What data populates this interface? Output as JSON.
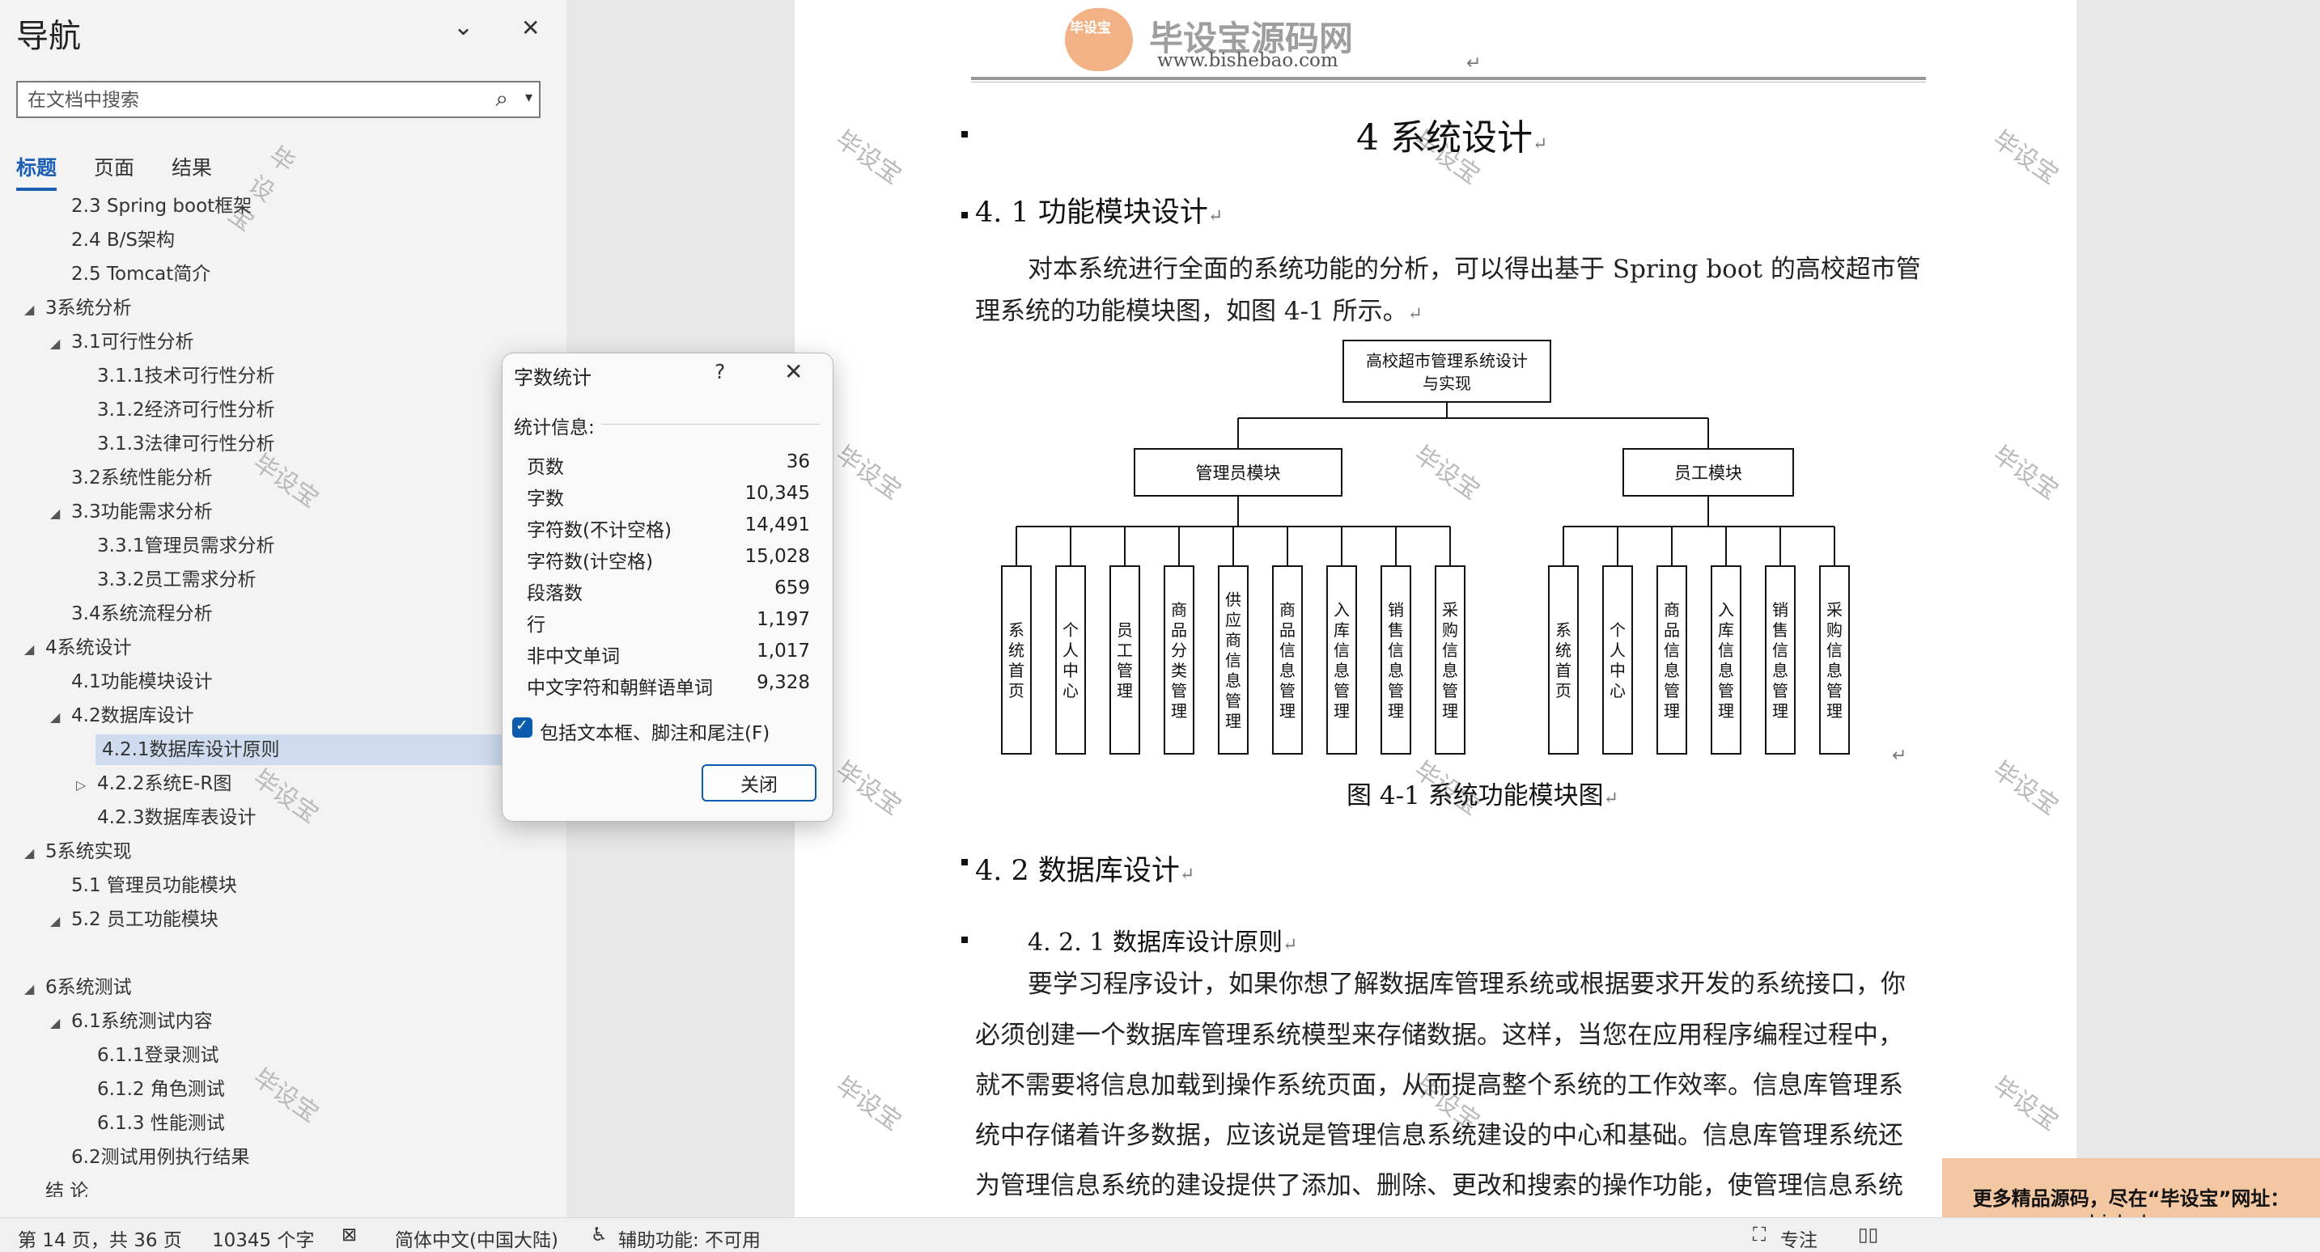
{
  "nav": {
    "title": "导航",
    "search_placeholder": "在文档中搜索",
    "tabs": [
      "标题",
      "页面",
      "结果"
    ],
    "tree": [
      {
        "label": "2.3 Spring boot框架",
        "indent": 2,
        "arrow": ""
      },
      {
        "label": "2.4 B/S架构",
        "indent": 2,
        "arrow": ""
      },
      {
        "label": "2.5 Tomcat简介",
        "indent": 2,
        "arrow": ""
      },
      {
        "label": "3系统分析",
        "indent": 1,
        "arrow": "◢"
      },
      {
        "label": "3.1可行性分析",
        "indent": 2,
        "arrow": "◢"
      },
      {
        "label": "3.1.1技术可行性分析",
        "indent": 3,
        "arrow": ""
      },
      {
        "label": "3.1.2经济可行性分析",
        "indent": 3,
        "arrow": ""
      },
      {
        "label": "3.1.3法律可行性分析",
        "indent": 3,
        "arrow": ""
      },
      {
        "label": "3.2系统性能分析",
        "indent": 2,
        "arrow": ""
      },
      {
        "label": "3.3功能需求分析",
        "indent": 2,
        "arrow": "◢"
      },
      {
        "label": "3.3.1管理员需求分析",
        "indent": 3,
        "arrow": ""
      },
      {
        "label": "3.3.2员工需求分析",
        "indent": 3,
        "arrow": ""
      },
      {
        "label": "3.4系统流程分析",
        "indent": 2,
        "arrow": ""
      },
      {
        "label": "4系统设计",
        "indent": 1,
        "arrow": "◢"
      },
      {
        "label": "4.1功能模块设计",
        "indent": 2,
        "arrow": ""
      },
      {
        "label": "4.2数据库设计",
        "indent": 2,
        "arrow": "◢"
      },
      {
        "label": "4.2.1数据库设计原则",
        "indent": 3,
        "arrow": "",
        "selected": true
      },
      {
        "label": "4.2.2系统E-R图",
        "indent": 3,
        "arrow": "▷"
      },
      {
        "label": "4.2.3数据库表设计",
        "indent": 3,
        "arrow": ""
      },
      {
        "label": "5系统实现",
        "indent": 1,
        "arrow": "◢"
      },
      {
        "label": "5.1  管理员功能模块",
        "indent": 2,
        "arrow": ""
      },
      {
        "label": "5.2 员工功能模块",
        "indent": 2,
        "arrow": "◢"
      },
      {
        "label": "",
        "indent": 2,
        "arrow": ""
      },
      {
        "label": "6系统测试",
        "indent": 1,
        "arrow": "◢"
      },
      {
        "label": "6.1系统测试内容",
        "indent": 2,
        "arrow": "◢"
      },
      {
        "label": "6.1.1登录测试",
        "indent": 3,
        "arrow": ""
      },
      {
        "label": "6.1.2 角色测试",
        "indent": 3,
        "arrow": ""
      },
      {
        "label": "6.1.3 性能测试",
        "indent": 3,
        "arrow": ""
      },
      {
        "label": "6.2测试用例执行结果",
        "indent": 2,
        "arrow": ""
      },
      {
        "label": "结  论",
        "indent": 1,
        "arrow": ""
      }
    ]
  },
  "doc": {
    "header_logo_text": "毕设宝源码网",
    "header_logo_badge": "毕设宝",
    "header_url": "www.bishebao.com",
    "watermark": "毕设宝",
    "chapter_title": "4 系统设计",
    "section_4_1": "4. 1 功能模块设计",
    "intro_line1": "对本系统进行全面的系统功能的分析，可以得出基于 Spring  boot 的高校超市管",
    "intro_line2": "理系统的功能模块图，如图 4-1 所示。",
    "figure_caption": "图 4-1  系统功能模块图",
    "section_4_2": "4. 2 数据库设计",
    "section_4_2_1": "4. 2. 1 数据库设计原则",
    "body_lines": [
      "要学习程序设计，如果你想了解数据库管理系统或根据要求开发的系统接口，你",
      "必须创建一个数据库管理系统模型来存储数据。这样，当您在应用程序编程过程中，",
      "就不需要将信息加载到操作系统页面，从而提高整个系统的工作效率。信息库管理系",
      "统中存储着许多数据，应该说是管理信息系统建设的中心和基础。信息库管理系统还",
      "为管理信息系统的建设提供了添加、删除、更改和搜索的操作功能，使管理信息系统"
    ],
    "para_mark": "↵"
  },
  "diagram": {
    "root": "高校超市管理系统设计与实现",
    "left_module": "管理员模块",
    "right_module": "员工模块",
    "left_leaves": [
      "系统首页",
      "个人中心",
      "员工管理",
      "商品分类管理",
      "供应商信息管理",
      "商品信息管理",
      "入库信息管理",
      "销售信息管理",
      "采购信息管理"
    ],
    "right_leaves": [
      "系统首页",
      "个人中心",
      "商品信息管理",
      "入库信息管理",
      "销售信息管理",
      "采购信息管理"
    ]
  },
  "dialog": {
    "title": "字数统计",
    "help": "?",
    "section_label": "统计信息:",
    "stats": [
      {
        "label": "页数",
        "value": "36"
      },
      {
        "label": "字数",
        "value": "10,345"
      },
      {
        "label": "字符数(不计空格)",
        "value": "14,491"
      },
      {
        "label": "字符数(计空格)",
        "value": "15,028"
      },
      {
        "label": "段落数",
        "value": "659"
      },
      {
        "label": "行",
        "value": "1,197"
      },
      {
        "label": "非中文单词",
        "value": "1,017"
      },
      {
        "label": "中文字符和朝鲜语单词",
        "value": "9,328"
      }
    ],
    "checkbox_label": "包括文本框、脚注和尾注(F)",
    "close_label": "关闭"
  },
  "status": {
    "page": "第 14 页，共 36 页",
    "words": "10345 个字",
    "language": "简体中文(中国大陆)",
    "accessibility": "辅助功能: 不可用",
    "focus": "专注"
  },
  "ad": {
    "line1": "更多精品源码，尽在“毕设宝”网址：",
    "line2": "www.bishebao.com"
  },
  "colors": {
    "accent": "#1a5fb4",
    "selection": "#cfdcf0",
    "ad": "#f4c7a3"
  }
}
